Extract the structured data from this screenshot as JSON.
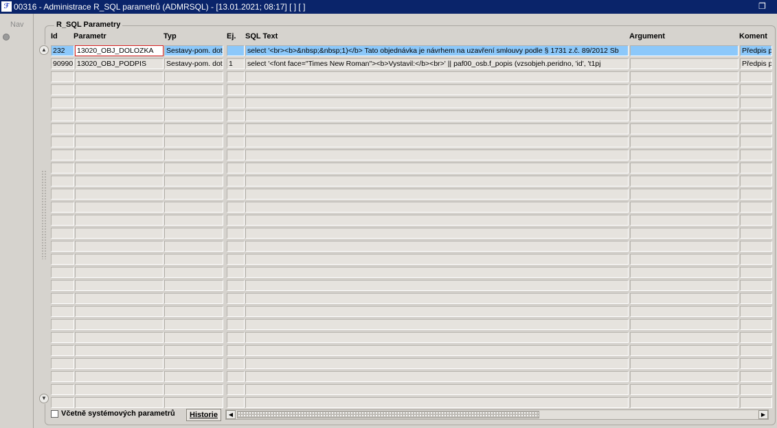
{
  "window": {
    "title": "00316 - Administrace R_SQL parametrů (ADMRSQL) - [13.01.2021; 08:17]  [ ] [ ]",
    "app_icon_text": "ℱ",
    "restore_icon": "restore-icon",
    "close_icon": "close-icon"
  },
  "side": {
    "nav_label": "Nav"
  },
  "group": {
    "title": "R_SQL Parametry"
  },
  "columns": {
    "id": "Id",
    "parametr": "Parametr",
    "typ": "Typ",
    "ej": "Ej.",
    "sql_text": "SQL Text",
    "argument": "Argument",
    "koment": "Koment"
  },
  "rows": [
    {
      "id": "232",
      "parametr": "13020_OBJ_DOLOZKA",
      "typ": "Sestavy-pom. dot",
      "ej": "",
      "sql_text": "select '<br><b>&nbsp;&nbsp;1)</b> Tato objednávka je návrhem na uzavření smlouvy podle § 1731 z.č. 89/2012 Sb",
      "argument": "",
      "koment": "Předpis p"
    },
    {
      "id": "90990",
      "parametr": "13020_OBJ_PODPIS",
      "typ": "Sestavy-pom. dot",
      "ej": "1",
      "sql_text": "select '<font face=\"Times New Roman\"><b>Vystavil:</b><br>'        || paf00_osb.f_popis (vzsobjeh.peridno, 'id', 't1pj",
      "argument": "",
      "koment": "Předpis p"
    }
  ],
  "empty_rows": 26,
  "footer": {
    "checkbox_label": "Včetně systémových parametrů",
    "checkbox_checked": false,
    "history_button": "Historie"
  },
  "colors": {
    "titlebar": "#0a246a",
    "selected_cell": "#8cc8fa",
    "focus_border": "#d62020"
  }
}
